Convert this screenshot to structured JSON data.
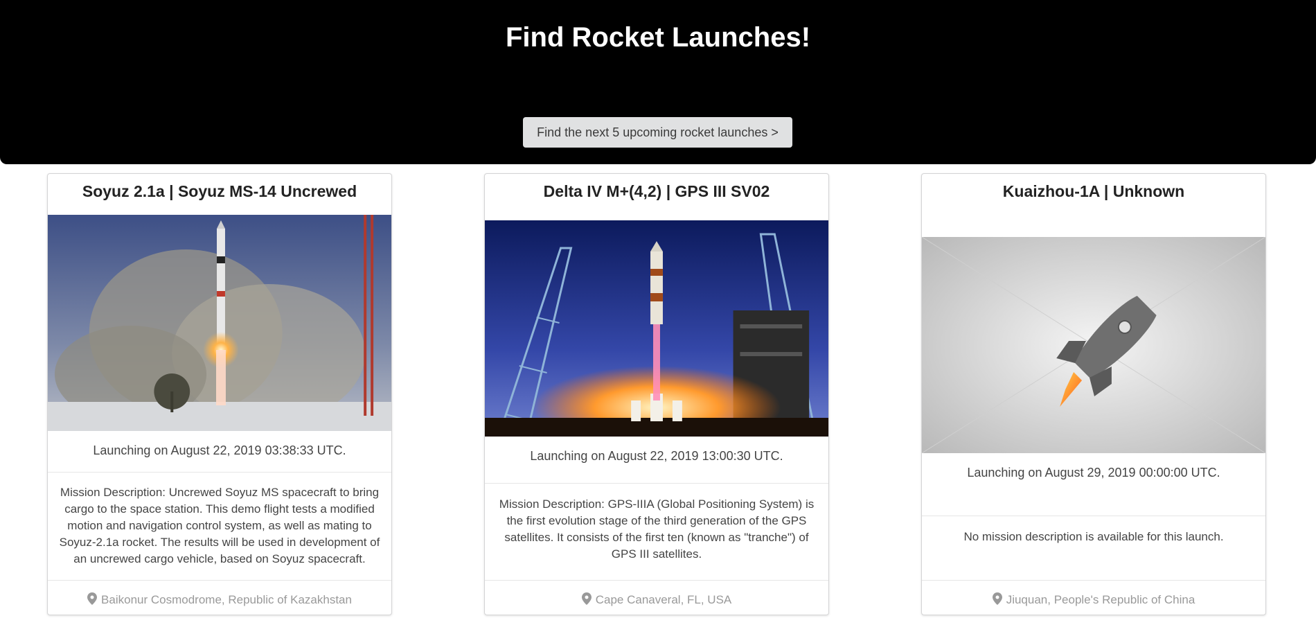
{
  "hero": {
    "title": "Find Rocket Launches!",
    "button_label": "Find the next 5 upcoming rocket launches >"
  },
  "launches": [
    {
      "name": "Soyuz 2.1a | Soyuz MS-14 Uncrewed",
      "launch_text": "Launching on August 22, 2019 03:38:33 UTC.",
      "description": "Mission Description: Uncrewed Soyuz MS spacecraft to bring cargo to the space station. This demo flight tests a modified motion and navigation control system, as well as mating to Soyuz-2.1a rocket. The results will be used in development of an uncrewed cargo vehicle, based on Soyuz spacecraft.",
      "location": "Baikonur Cosmodrome, Republic of Kazakhstan"
    },
    {
      "name": "Delta IV M+(4,2) | GPS III SV02",
      "launch_text": "Launching on August 22, 2019 13:00:30 UTC.",
      "description": "Mission Description: GPS-IIIA (Global Positioning System) is the first evolution stage of the third generation of the GPS satellites. It consists of the first ten (known as \"tranche\") of GPS III satellites.",
      "location": "Cape Canaveral, FL, USA"
    },
    {
      "name": "Kuaizhou-1A | Unknown",
      "launch_text": "Launching on August 29, 2019 00:00:00 UTC.",
      "description": "No mission description is available for this launch.",
      "location": "Jiuquan, People's Republic of China"
    }
  ],
  "icons": {
    "location": "map-pin-icon",
    "placeholder": "rocket-icon"
  },
  "colors": {
    "hero_bg": "#000000",
    "button_bg": "#e0e1e2",
    "location_text": "#999999"
  }
}
